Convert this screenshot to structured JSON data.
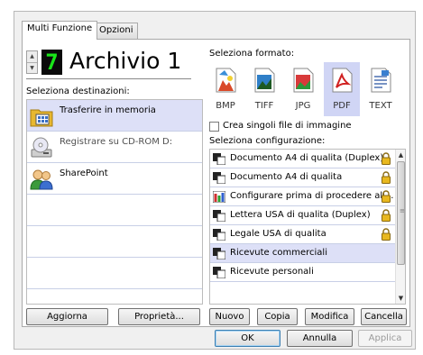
{
  "tabs": [
    {
      "label": "Multi Funzione",
      "active": true
    },
    {
      "label": "Opzioni",
      "active": false
    }
  ],
  "profile": {
    "number": "7",
    "name": "Archivio 1"
  },
  "destinations": {
    "label": "Seleziona destinazioni:",
    "items": [
      {
        "label": "Trasferire in memoria",
        "icon": "folder-grid-icon",
        "selected": true,
        "enabled": true
      },
      {
        "label": "Registrare su CD-ROM  D:",
        "icon": "cd-rom-drive-icon",
        "selected": false,
        "enabled": false
      },
      {
        "label": "SharePoint",
        "icon": "sharepoint-icon",
        "selected": false,
        "enabled": true
      }
    ],
    "refresh_button": "Aggiorna",
    "properties_button": "Proprietà..."
  },
  "formats": {
    "label": "Seleziona formato:",
    "items": [
      {
        "label": "BMP",
        "icon": "bmp-file-icon",
        "selected": false
      },
      {
        "label": "TIFF",
        "icon": "tiff-file-icon",
        "selected": false
      },
      {
        "label": "JPG",
        "icon": "jpg-file-icon",
        "selected": false
      },
      {
        "label": "PDF",
        "icon": "pdf-file-icon",
        "selected": true
      },
      {
        "label": "TEXT",
        "icon": "text-file-icon",
        "selected": false
      }
    ],
    "single_files_checkbox": {
      "label": "Crea singoli file di immagine",
      "checked": false
    }
  },
  "configurations": {
    "label": "Seleziona configurazione:",
    "items": [
      {
        "label": "Documento A4 di qualita (Duplex)",
        "icon": "scanner-config-icon",
        "locked": true,
        "selected": false
      },
      {
        "label": "Documento A4 di qualita",
        "icon": "scanner-config-icon",
        "locked": true,
        "selected": false
      },
      {
        "label": "Configurare prima di procedere all...",
        "icon": "configure-before-scan-icon",
        "locked": true,
        "selected": false
      },
      {
        "label": "Lettera USA di qualita (Duplex)",
        "icon": "scanner-config-icon",
        "locked": true,
        "selected": false
      },
      {
        "label": "Legale USA di qualita",
        "icon": "scanner-config-icon",
        "locked": true,
        "selected": false
      },
      {
        "label": "Ricevute commerciali",
        "icon": "scanner-config-icon",
        "locked": false,
        "selected": true
      },
      {
        "label": "Ricevute personali",
        "icon": "scanner-config-icon",
        "locked": false,
        "selected": false
      }
    ],
    "buttons": {
      "new": "Nuovo",
      "copy": "Copia",
      "edit": "Modifica",
      "delete": "Cancella"
    }
  },
  "dialog_buttons": {
    "ok": "OK",
    "cancel": "Annulla",
    "apply": "Applica"
  },
  "colors": {
    "selection": "#dde0f7",
    "format_selection": "#d0d5f5",
    "digit_text": "#19e619",
    "digit_bg": "#0a0a0a"
  }
}
